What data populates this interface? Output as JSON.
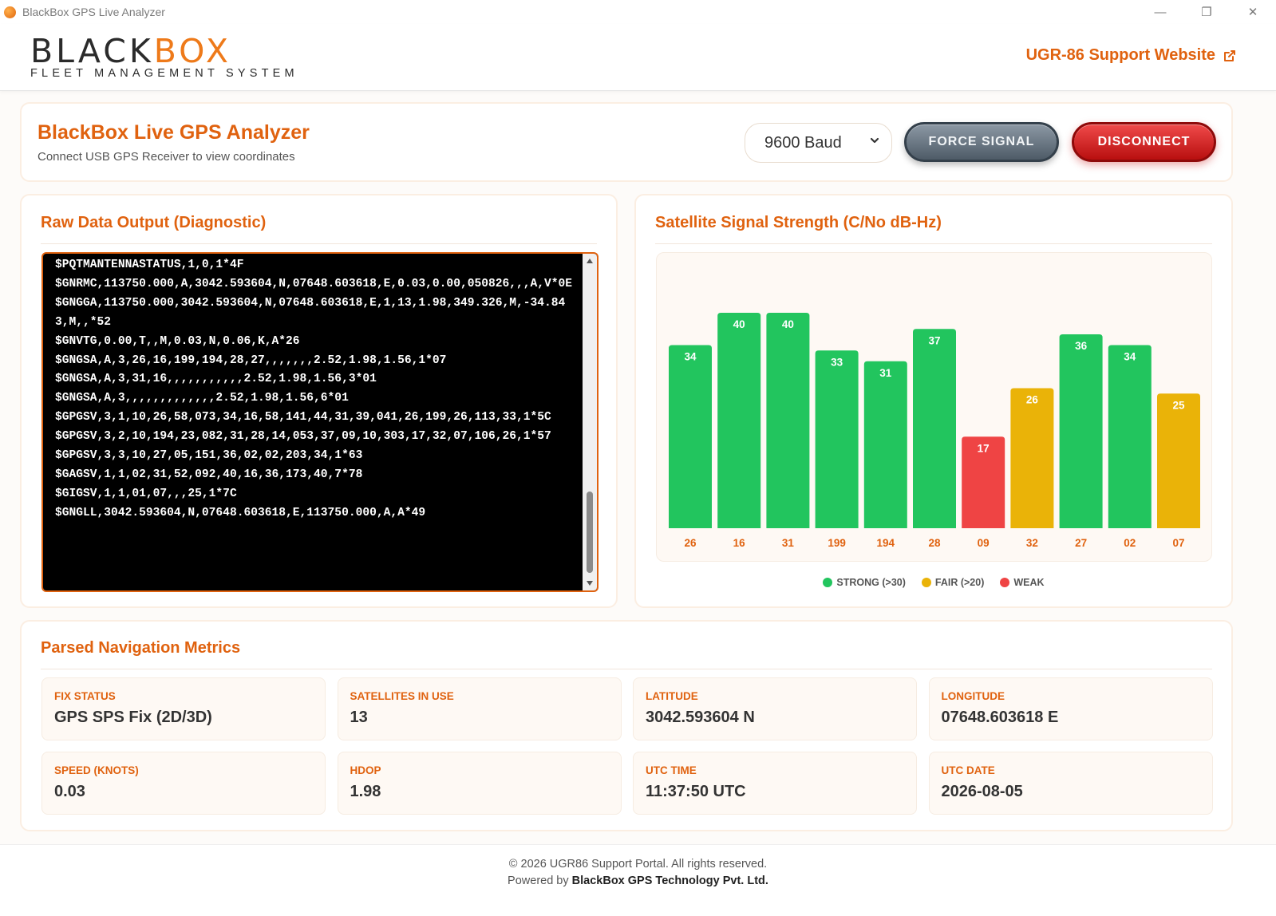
{
  "window": {
    "title": "BlackBox GPS Live Analyzer",
    "minimize": "—",
    "restore": "❐",
    "close": "✕"
  },
  "header": {
    "logo_black": "BLACK",
    "logo_box": "BOX",
    "logo_sub": "FLEET MANAGEMENT SYSTEM",
    "support_link": "UGR-86 Support Website"
  },
  "top": {
    "title": "BlackBox Live GPS Analyzer",
    "subtitle": "Connect USB GPS Receiver to view coordinates",
    "baud": "9600 Baud",
    "force_label": "FORCE SIGNAL",
    "disconnect_label": "DISCONNECT"
  },
  "raw": {
    "title": "Raw Data Output (Diagnostic)",
    "lines": [
      "$PQTMANTENNASTATUS,1,0,1*4F",
      "$GNRMC,113750.000,A,3042.593604,N,07648.603618,E,0.03,0.00,050826,,,A,V*0E",
      "$GNGGA,113750.000,3042.593604,N,07648.603618,E,1,13,1.98,349.326,M,-34.843,M,,*52",
      "$GNVTG,0.00,T,,M,0.03,N,0.06,K,A*26",
      "$GNGSA,A,3,26,16,199,194,28,27,,,,,,,2.52,1.98,1.56,1*07",
      "$GNGSA,A,3,31,16,,,,,,,,,,,2.52,1.98,1.56,3*01",
      "$GNGSA,A,3,,,,,,,,,,,,,2.52,1.98,1.56,6*01",
      "$GPGSV,3,1,10,26,58,073,34,16,58,141,44,31,39,041,26,199,26,113,33,1*5C",
      "$GPGSV,3,2,10,194,23,082,31,28,14,053,37,09,10,303,17,32,07,106,26,1*57",
      "$GPGSV,3,3,10,27,05,151,36,02,02,203,34,1*63",
      "$GAGSV,1,1,02,31,52,092,40,16,36,173,40,7*78",
      "$GIGSV,1,1,01,07,,,25,1*7C",
      "$GNGLL,3042.593604,N,07648.603618,E,113750.000,A,A*49"
    ]
  },
  "satellites": {
    "title": "Satellite Signal Strength (C/No dB-Hz)",
    "legend": [
      {
        "label": "STRONG (>30)",
        "color": "#22c55e"
      },
      {
        "label": "FAIR (>20)",
        "color": "#eab308"
      },
      {
        "label": "WEAK",
        "color": "#ef4444"
      }
    ]
  },
  "chart_data": {
    "type": "bar",
    "title": "Satellite Signal Strength (C/No dB-Hz)",
    "categories": [
      "26",
      "16",
      "31",
      "199",
      "194",
      "28",
      "09",
      "32",
      "27",
      "02",
      "07"
    ],
    "values": [
      34,
      40,
      40,
      33,
      31,
      37,
      17,
      26,
      36,
      34,
      25
    ],
    "colors": [
      "#22c55e",
      "#22c55e",
      "#22c55e",
      "#22c55e",
      "#22c55e",
      "#22c55e",
      "#ef4444",
      "#eab308",
      "#22c55e",
      "#22c55e",
      "#eab308"
    ],
    "ylim": [
      0,
      50
    ],
    "grid": false
  },
  "metrics": {
    "title": "Parsed Navigation Metrics",
    "items": [
      {
        "label": "FIX STATUS",
        "value": "GPS SPS Fix (2D/3D)"
      },
      {
        "label": "SATELLITES IN USE",
        "value": "13"
      },
      {
        "label": "LATITUDE",
        "value": "3042.593604 N"
      },
      {
        "label": "LONGITUDE",
        "value": "07648.603618 E"
      },
      {
        "label": "SPEED (KNOTS)",
        "value": "0.03"
      },
      {
        "label": "HDOP",
        "value": "1.98"
      },
      {
        "label": "UTC TIME",
        "value": "11:37:50 UTC"
      },
      {
        "label": "UTC DATE",
        "value": "2026-08-05"
      }
    ]
  },
  "footer": {
    "line1": "© 2026 UGR86 Support Portal. All rights reserved.",
    "powered_prefix": "Powered by ",
    "powered_company": "BlackBox GPS Technology Pvt. Ltd."
  }
}
